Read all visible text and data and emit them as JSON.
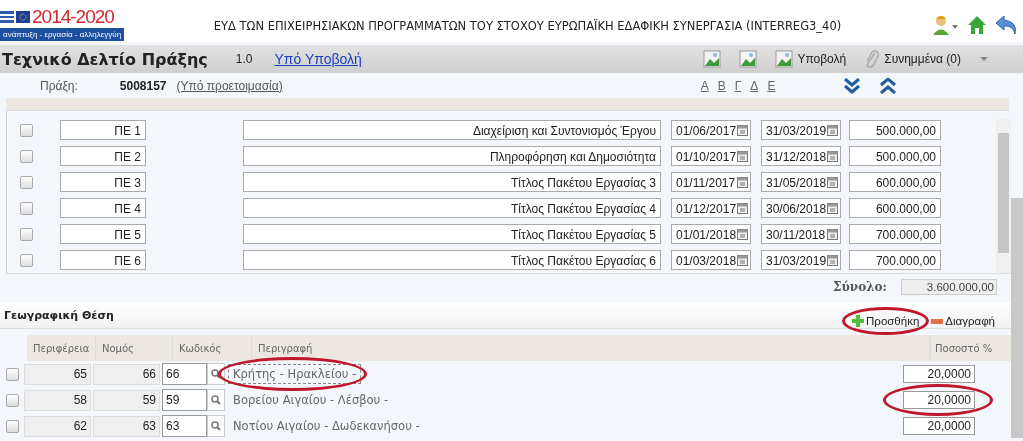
{
  "header": {
    "logo_years": "2014-2020",
    "logo_tagline": "ανάπτυξη - εργασία - αλληλεγγύη",
    "title": "ΕΥΔ ΤΩΝ ΕΠΙΧΕΙΡΗΣΙΑΚΩΝ ΠΡΟΓΡΑΜΜΑΤΩΝ ΤΟΥ ΣΤΟΧΟΥ ΕΥΡΩΠΑΪΚΗ ΕΔΑΦΙΚΗ ΣΥΝΕΡΓΑΣΙΑ (INTERREG3_40)"
  },
  "toolbar": {
    "title": "Τεχνικό Δελτίο Πράξης",
    "version": "1.0",
    "status_link": "Υπό Υποβολή",
    "actions": [
      {
        "kind": "image"
      },
      {
        "kind": "image"
      },
      {
        "kind": "image",
        "label": "Υποβολή"
      },
      {
        "kind": "attach",
        "label": "Συνημμένα (0)"
      }
    ]
  },
  "project": {
    "label": "Πράξη:",
    "code": "5008157",
    "status": "(Υπό προετοιμασία)",
    "letters": [
      "Α",
      "Β",
      "Γ",
      "Δ",
      "Ε"
    ]
  },
  "work_packages": {
    "rows": [
      {
        "checked": false,
        "code": "ΠΕ 1",
        "description": "Διαχείριση και Συντονισμός Έργου",
        "start": "01/06/2017",
        "end": "31/03/2019",
        "cost": "500.000,00"
      },
      {
        "checked": false,
        "code": "ΠΕ 2",
        "description": "Πληροφόρηση και Δημοσιότητα",
        "start": "01/10/2017",
        "end": "31/12/2018",
        "cost": "500.000,00"
      },
      {
        "checked": false,
        "code": "ΠΕ 3",
        "description": "Τίτλος Πακέτου Εργασίας 3",
        "start": "01/11/2017",
        "end": "31/05/2018",
        "cost": "600.000,00"
      },
      {
        "checked": false,
        "code": "ΠΕ 4",
        "description": "Τίτλος Πακέτου Εργασίας 4",
        "start": "01/12/2017",
        "end": "30/06/2018",
        "cost": "600.000,00"
      },
      {
        "checked": false,
        "code": "ΠΕ 5",
        "description": "Τίτλος Πακέτου Εργασίας 5",
        "start": "01/01/2018",
        "end": "30/11/2018",
        "cost": "700.000,00"
      },
      {
        "checked": false,
        "code": "ΠΕ 6",
        "description": "Τίτλος Πακέτου Εργασίας 6",
        "start": "01/03/2018",
        "end": "31/03/2019",
        "cost": "700.000,00"
      }
    ],
    "total_label": "Σύνολο:",
    "total": "3.600.000,00"
  },
  "geography": {
    "title": "Γεωγραφική Θέση",
    "actions": [
      {
        "kind": "add",
        "label": "Προσθήκη",
        "highlighted": true
      },
      {
        "kind": "delete",
        "label": "Διαγραφή",
        "highlighted": false
      }
    ],
    "columns": [
      "Περιφέρεια",
      "Νομός",
      "Κωδικός",
      "Περιγραφή",
      "Ποσοστό %"
    ],
    "rows": [
      {
        "checked": false,
        "region": "65",
        "prefecture": "66",
        "code": "66",
        "description": "Κρήτης - Ηρακλείου -",
        "percent": "20,0000",
        "description_highlighted": true,
        "percent_highlighted": false
      },
      {
        "checked": false,
        "region": "58",
        "prefecture": "59",
        "code": "59",
        "description": "Βορείου Αιγαίου - Λέσβου -",
        "percent": "20,0000",
        "description_highlighted": false,
        "percent_highlighted": true
      },
      {
        "checked": false,
        "region": "62",
        "prefecture": "63",
        "code": "63",
        "description": "Νοτίου Αιγαίου - Δωδεκανήσου -",
        "percent": "20,0000",
        "description_highlighted": false,
        "percent_highlighted": false
      }
    ]
  }
}
